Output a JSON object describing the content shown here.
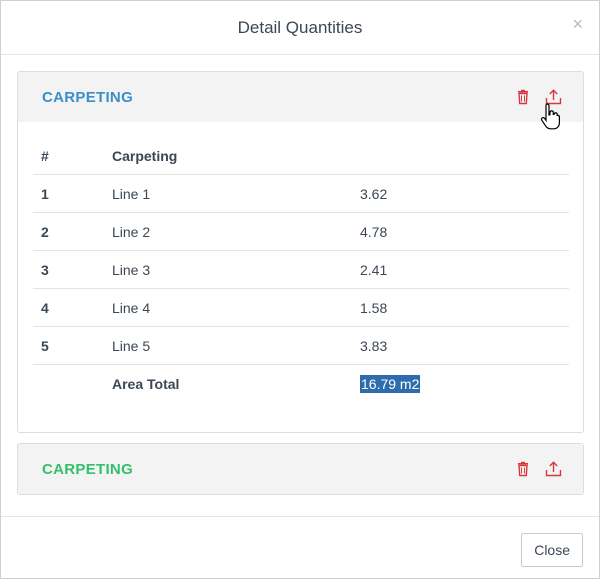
{
  "modal": {
    "title": "Detail Quantities",
    "close_symbol": "×",
    "footer_close_label": "Close"
  },
  "colors": {
    "title_blue": "#3a8fc9",
    "title_green": "#34c06a",
    "action_red": "#d9363e",
    "selection": "#2f6cae"
  },
  "panels": [
    {
      "title": "CARPETING",
      "icons": [
        "trash-icon",
        "upload-icon"
      ],
      "table": {
        "headers": [
          "#",
          "Carpeting",
          ""
        ],
        "rows": [
          {
            "num": "1",
            "name": "Line 1",
            "value": "3.62"
          },
          {
            "num": "2",
            "name": "Line 2",
            "value": "4.78"
          },
          {
            "num": "3",
            "name": "Line 3",
            "value": "2.41"
          },
          {
            "num": "4",
            "name": "Line 4",
            "value": "1.58"
          },
          {
            "num": "5",
            "name": "Line 5",
            "value": "3.83"
          }
        ],
        "total_label": "Area Total",
        "total_value": "16.79 m2"
      }
    },
    {
      "title": "CARPETING",
      "icons": [
        "trash-icon",
        "upload-icon"
      ]
    }
  ]
}
